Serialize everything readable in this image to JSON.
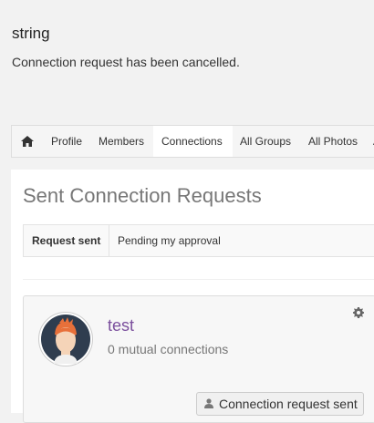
{
  "notice": {
    "title": "string",
    "message": "Connection request has been cancelled."
  },
  "nav": {
    "items": [
      {
        "label": "Profile"
      },
      {
        "label": "Members"
      },
      {
        "label": "Connections",
        "active": true
      },
      {
        "label": "All Groups"
      },
      {
        "label": "All Photos"
      },
      {
        "label": "A"
      }
    ]
  },
  "main": {
    "title": "Sent Connection Requests",
    "tabs": [
      {
        "label": "Request sent",
        "active": true
      },
      {
        "label": "Pending my approval"
      }
    ]
  },
  "card": {
    "name": "test",
    "mutual": "0 mutual connections",
    "button_label": "Connection request sent"
  },
  "colors": {
    "link": "#7b4f9d",
    "avatar_ring": "#2f3d4f",
    "avatar_hair": "#e8703a"
  }
}
